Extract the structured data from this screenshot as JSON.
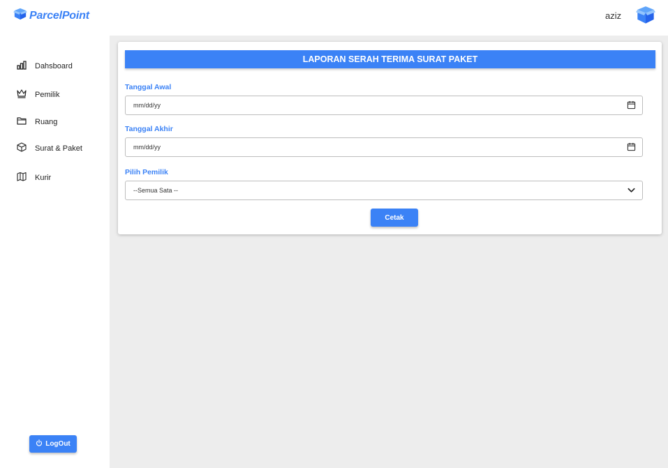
{
  "header": {
    "brand": "ParcelPoint",
    "username": "aziz",
    "logo_icon": "box-icon",
    "avatar_icon": "box-icon"
  },
  "sidebar": {
    "items": [
      {
        "label": "Dahsboard",
        "icon": "bar-chart-icon"
      },
      {
        "label": "Pemilik",
        "icon": "crown-icon"
      },
      {
        "label": "Ruang",
        "icon": "folder-icon"
      },
      {
        "label": "Surat & Paket",
        "icon": "package-icon"
      },
      {
        "label": "Kurir",
        "icon": "map-icon"
      }
    ],
    "logout_label": "LogOut"
  },
  "form": {
    "title": "LAPORAN SERAH TERIMA SURAT PAKET",
    "start_date_label": "Tanggal Awal",
    "start_date_placeholder": "mm/dd/yy",
    "end_date_label": "Tanggal Akhir",
    "end_date_placeholder": "mm/dd/yy",
    "owner_label": "Pilih Pemilik",
    "owner_selected": "--Semua Sata --",
    "print_label": "Cetak"
  },
  "colors": {
    "accent": "#3b82f6",
    "background": "#ededed"
  }
}
